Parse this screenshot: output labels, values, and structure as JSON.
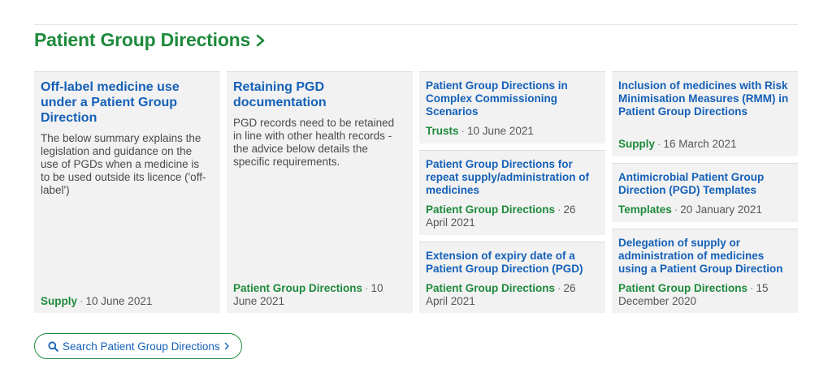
{
  "section": {
    "title": "Patient Group Directions",
    "chevron_icon": "chevron-right-icon"
  },
  "columns": [
    {
      "cards": [
        {
          "title": "Off-label medicine use under a Patient Group Direction",
          "summary": "The below summary explains the legislation and guidance on the use of PGDs when a medicine is to be used outside its licence ('off-label')",
          "category": "Supply",
          "date": "10 June 2021"
        }
      ]
    },
    {
      "cards": [
        {
          "title": "Retaining PGD documentation",
          "summary": "PGD records need to be retained in line with other health records - the advice below details the specific requirements.",
          "category": "Patient Group Directions",
          "date": "10 June 2021"
        }
      ]
    },
    {
      "cards": [
        {
          "title": "Patient Group Directions in Complex Commissioning Scenarios",
          "category": "Trusts",
          "date": "10 June 2021"
        },
        {
          "title": "Patient Group Directions for repeat supply/administration of medicines",
          "category": "Patient Group Directions",
          "date": "26 April 2021"
        },
        {
          "title": "Extension of expiry date of a Patient Group Direction (PGD)",
          "category": "Patient Group Directions",
          "date": "26 April 2021"
        }
      ]
    },
    {
      "cards": [
        {
          "title": "Inclusion of medicines with Risk Minimisation Measures (RMM) in Patient Group Directions",
          "category": "Supply",
          "date": "16 March 2021"
        },
        {
          "title": "Antimicrobial Patient Group Direction (PGD) Templates",
          "category": "Templates",
          "date": "20 January 2021"
        },
        {
          "title": "Delegation of supply or administration of medicines using a Patient Group Direction",
          "category": "Patient Group Directions",
          "date": "15 December 2020"
        }
      ]
    }
  ],
  "meta_separator": "·",
  "search_button": {
    "label": "Search Patient Group Directions",
    "icon": "search-icon",
    "chevron_icon": "chevron-right-icon"
  },
  "colors": {
    "brand_green": "#1e8a3c",
    "link_blue": "#1460b8",
    "card_bg": "#f2f2f2"
  }
}
